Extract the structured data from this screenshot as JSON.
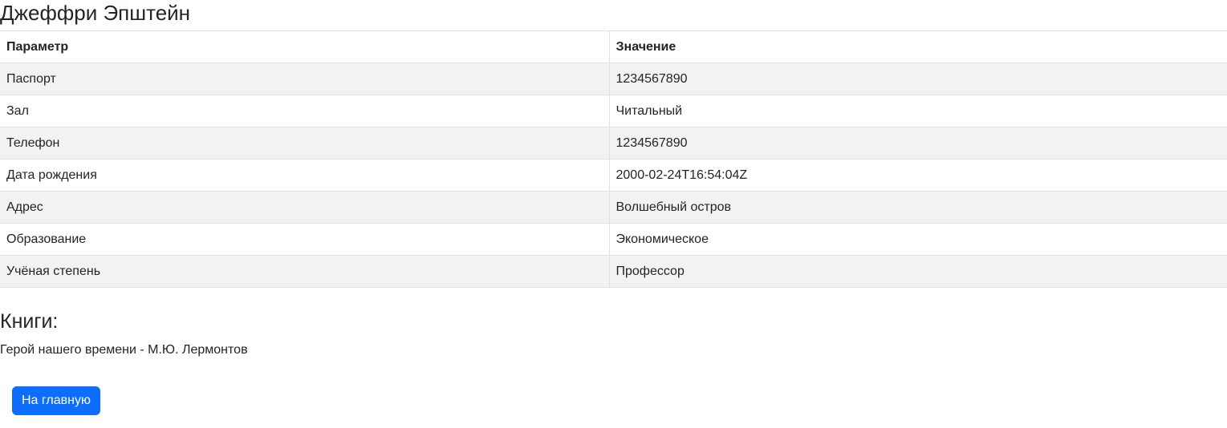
{
  "header": {
    "title": "Джеффри Эпштейн"
  },
  "table": {
    "columns": [
      "Параметр",
      "Значение"
    ],
    "rows": [
      {
        "param": "Паспорт",
        "value": "1234567890"
      },
      {
        "param": "Зал",
        "value": "Читальный"
      },
      {
        "param": "Телефон",
        "value": "1234567890"
      },
      {
        "param": "Дата рождения",
        "value": "2000-02-24T16:54:04Z"
      },
      {
        "param": "Адрес",
        "value": "Волшебный остров"
      },
      {
        "param": "Образование",
        "value": "Экономическое"
      },
      {
        "param": "Учёная степень",
        "value": "Профессор"
      }
    ]
  },
  "books": {
    "title": "Книги:",
    "items": [
      "Герой нашего времени - М.Ю. Лермонтов"
    ]
  },
  "actions": {
    "home_label": "На главную"
  },
  "colors": {
    "primary_button": "#0d6efd",
    "striped_row": "#f2f2f2",
    "border": "#dee2e6",
    "text": "#212529"
  }
}
